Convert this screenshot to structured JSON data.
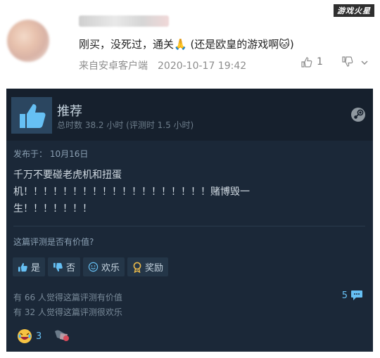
{
  "post": {
    "text": "刚买，没死过，通关🙏 (还是欧皇的游戏啊🐱)",
    "source": "来自安卓客户端",
    "timestamp": "2020-10-17 19:42",
    "likes": "1",
    "watermark": "游戏火星"
  },
  "review": {
    "title": "推荐",
    "hours": "总时数 38.2 小时  (评测时 1.5 小时)",
    "posted": "发布于：  10月16日",
    "body_line1": "千万不要碰老虎机和扭蛋",
    "body_line2": "机！！！！！！！！！！！！！！！！！！！赌博毁一",
    "body_line3": "生！！！！！！！",
    "helpful_question": "这篇评测是否有价值?",
    "buttons": {
      "yes": "是",
      "no": "否",
      "funny": "欢乐",
      "award": "奖励"
    },
    "helpful_count": "有 66 人觉得这篇评测有价值",
    "funny_count": "有 32 人觉得这篇评测很欢乐",
    "comments": "5",
    "award_count": "3"
  },
  "colors": {
    "card_bg": "#1b2838",
    "header_bg": "#16202d",
    "accent_blue": "#66c0f4",
    "text_light": "#c6d4df"
  }
}
